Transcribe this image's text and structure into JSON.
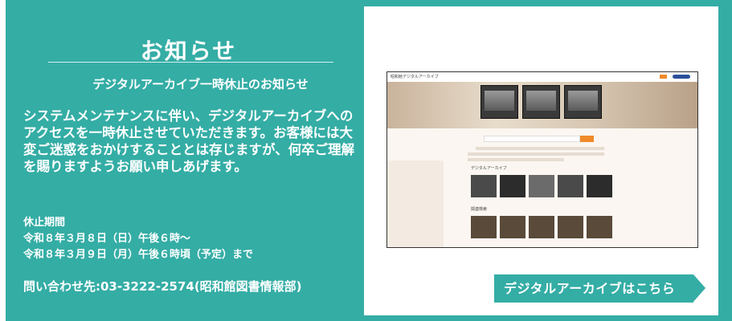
{
  "notice": {
    "title": "お知らせ",
    "subtitle": "デジタルアーカイブ一時休止のお知らせ",
    "body": "システムメンテナンスに伴い、デジタルアーカイブへのアクセスを一時休止させていただきます。お客様には大変ご迷惑をおかけすることとは存じますが、何卒ご理解を賜りますようお願い申しあげます。",
    "period_label": "休止期間",
    "period_start": "令和８年３月８日（日）午後６時～",
    "period_end": "令和８年３月９日（月）午後６時頃（予定）まで",
    "contact": "問い合わせ先:03-3222-2574(昭和館図書情報部)"
  },
  "thumbnail": {
    "site_title": "昭和館デジタルアーカイブ",
    "section_digital_archive": "デジタルアーカイブ",
    "section_related": "関連検索"
  },
  "cta": {
    "label": "デジタルアーカイブはこちら"
  },
  "colors": {
    "accent": "#34ada5",
    "orange": "#f08a2a",
    "navy": "#2b4f9a"
  }
}
